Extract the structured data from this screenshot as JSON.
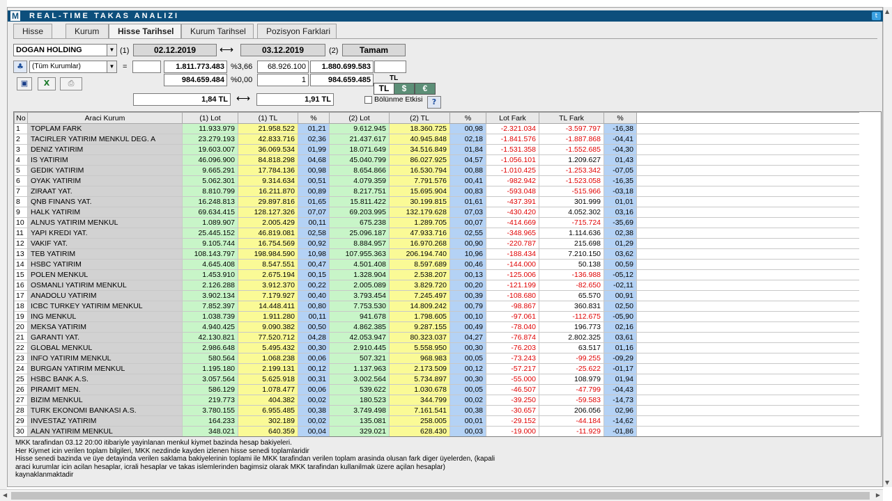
{
  "app": {
    "logo": "M",
    "title": "REAL-TIME TAKAS ANALIZI",
    "twitter_icon": "twitter-icon"
  },
  "tabs": [
    {
      "label": "Hisse",
      "active": false
    },
    {
      "label": "Kurum",
      "active": false
    },
    {
      "label": "Hisse Tarihsel",
      "active": true
    },
    {
      "label": "Kurum Tarihsel",
      "active": false
    },
    {
      "label": "Pozisyon Farklari",
      "active": false
    }
  ],
  "controls": {
    "stock_select": "DOGAN HOLDING",
    "label_1": "(1)",
    "date_1": "02.12.2019",
    "range_arrow": "⟷",
    "date_2": "03.12.2019",
    "label_2": "(2)",
    "ok_button": "Tamam",
    "broker_select": "(Tüm Kurumlar)",
    "equals": "=",
    "r1_total1": "1.811.773.483",
    "r1_pct": "%3,66",
    "r1_diff": "68.926.100",
    "r1_total2": "1.880.699.583",
    "r2_total1": "984.659.484",
    "r2_pct": "%0,00",
    "r2_diff": "1",
    "r2_total2": "984.659.485",
    "currency_label": "TL",
    "cur_tl": "TL",
    "cur_usd": "$",
    "cur_eur": "€",
    "price_1": "1,84 TL",
    "price_2": "1,91 TL",
    "split_effect_label": "Bölünme Etkisi",
    "help": "?"
  },
  "table": {
    "headers": [
      "No",
      "Araci Kurum",
      "(1) Lot",
      "(1) TL",
      "%",
      "(2) Lot",
      "(2) TL",
      "%",
      "Lot Fark",
      "TL Fark",
      "%"
    ],
    "rows": [
      [
        "1",
        "TOPLAM FARK",
        "11.933.979",
        "21.958.522",
        "01,21",
        "9.612.945",
        "18.360.725",
        "00,98",
        "-2.321.034",
        "-3.597.797",
        "-16,38"
      ],
      [
        "2",
        "TACIRLER YATIRIM MENKUL DEG. A",
        "23.279.193",
        "42.833.716",
        "02,36",
        "21.437.617",
        "40.945.848",
        "02,18",
        "-1.841.576",
        "-1.887.868",
        "-04,41"
      ],
      [
        "3",
        "DENIZ YATIRIM",
        "19.603.007",
        "36.069.534",
        "01,99",
        "18.071.649",
        "34.516.849",
        "01,84",
        "-1.531.358",
        "-1.552.685",
        "-04,30"
      ],
      [
        "4",
        "IS YATIRIM",
        "46.096.900",
        "84.818.298",
        "04,68",
        "45.040.799",
        "86.027.925",
        "04,57",
        "-1.056.101",
        "1.209.627",
        "01,43"
      ],
      [
        "5",
        "GEDIK YATIRIM",
        "9.665.291",
        "17.784.136",
        "00,98",
        "8.654.866",
        "16.530.794",
        "00,88",
        "-1.010.425",
        "-1.253.342",
        "-07,05"
      ],
      [
        "6",
        "OYAK YATIRIM",
        "5.062.301",
        "9.314.634",
        "00,51",
        "4.079.359",
        "7.791.576",
        "00,41",
        "-982.942",
        "-1.523.058",
        "-16,35"
      ],
      [
        "7",
        "ZIRAAT YAT.",
        "8.810.799",
        "16.211.870",
        "00,89",
        "8.217.751",
        "15.695.904",
        "00,83",
        "-593.048",
        "-515.966",
        "-03,18"
      ],
      [
        "8",
        "QNB FINANS YAT.",
        "16.248.813",
        "29.897.816",
        "01,65",
        "15.811.422",
        "30.199.815",
        "01,61",
        "-437.391",
        "301.999",
        "01,01"
      ],
      [
        "9",
        "HALK YATIRIM",
        "69.634.415",
        "128.127.326",
        "07,07",
        "69.203.995",
        "132.179.628",
        "07,03",
        "-430.420",
        "4.052.302",
        "03,16"
      ],
      [
        "10",
        "ALNUS YATIRIM MENKUL",
        "1.089.907",
        "2.005.429",
        "00,11",
        "675.238",
        "1.289.705",
        "00,07",
        "-414.669",
        "-715.724",
        "-35,69"
      ],
      [
        "11",
        "YAPI KREDI YAT.",
        "25.445.152",
        "46.819.081",
        "02,58",
        "25.096.187",
        "47.933.716",
        "02,55",
        "-348.965",
        "1.114.636",
        "02,38"
      ],
      [
        "12",
        "VAKIF YAT.",
        "9.105.744",
        "16.754.569",
        "00,92",
        "8.884.957",
        "16.970.268",
        "00,90",
        "-220.787",
        "215.698",
        "01,29"
      ],
      [
        "13",
        "TEB YATIRIM",
        "108.143.797",
        "198.984.590",
        "10,98",
        "107.955.363",
        "206.194.740",
        "10,96",
        "-188.434",
        "7.210.150",
        "03,62"
      ],
      [
        "14",
        "HSBC YATIRIM",
        "4.645.408",
        "8.547.551",
        "00,47",
        "4.501.408",
        "8.597.689",
        "00,46",
        "-144.000",
        "50.138",
        "00,59"
      ],
      [
        "15",
        "POLEN MENKUL",
        "1.453.910",
        "2.675.194",
        "00,15",
        "1.328.904",
        "2.538.207",
        "00,13",
        "-125.006",
        "-136.988",
        "-05,12"
      ],
      [
        "16",
        "OSMANLI YATIRIM MENKUL",
        "2.126.288",
        "3.912.370",
        "00,22",
        "2.005.089",
        "3.829.720",
        "00,20",
        "-121.199",
        "-82.650",
        "-02,11"
      ],
      [
        "17",
        "ANADOLU YATIRIM",
        "3.902.134",
        "7.179.927",
        "00,40",
        "3.793.454",
        "7.245.497",
        "00,39",
        "-108.680",
        "65.570",
        "00,91"
      ],
      [
        "18",
        "ICBC TURKEY YATIRIM MENKUL",
        "7.852.397",
        "14.448.411",
        "00,80",
        "7.753.530",
        "14.809.242",
        "00,79",
        "-98.867",
        "360.831",
        "02,50"
      ],
      [
        "19",
        "ING MENKUL",
        "1.038.739",
        "1.911.280",
        "00,11",
        "941.678",
        "1.798.605",
        "00,10",
        "-97.061",
        "-112.675",
        "-05,90"
      ],
      [
        "20",
        "MEKSA YATIRIM",
        "4.940.425",
        "9.090.382",
        "00,50",
        "4.862.385",
        "9.287.155",
        "00,49",
        "-78.040",
        "196.773",
        "02,16"
      ],
      [
        "21",
        "GARANTI YAT.",
        "42.130.821",
        "77.520.712",
        "04,28",
        "42.053.947",
        "80.323.037",
        "04,27",
        "-76.874",
        "2.802.325",
        "03,61"
      ],
      [
        "22",
        "GLOBAL MENKUL",
        "2.986.648",
        "5.495.432",
        "00,30",
        "2.910.445",
        "5.558.950",
        "00,30",
        "-76.203",
        "63.517",
        "01,16"
      ],
      [
        "23",
        "INFO YATIRIM MENKUL",
        "580.564",
        "1.068.238",
        "00,06",
        "507.321",
        "968.983",
        "00,05",
        "-73.243",
        "-99.255",
        "-09,29"
      ],
      [
        "24",
        "BURGAN YATIRIM MENKUL",
        "1.195.180",
        "2.199.131",
        "00,12",
        "1.137.963",
        "2.173.509",
        "00,12",
        "-57.217",
        "-25.622",
        "-01,17"
      ],
      [
        "25",
        "HSBC BANK A.S.",
        "3.057.564",
        "5.625.918",
        "00,31",
        "3.002.564",
        "5.734.897",
        "00,30",
        "-55.000",
        "108.979",
        "01,94"
      ],
      [
        "26",
        "PIRAMIT MEN.",
        "586.129",
        "1.078.477",
        "00,06",
        "539.622",
        "1.030.678",
        "00,05",
        "-46.507",
        "-47.799",
        "-04,43"
      ],
      [
        "27",
        "BIZIM MENKUL",
        "219.773",
        "404.382",
        "00,02",
        "180.523",
        "344.799",
        "00,02",
        "-39.250",
        "-59.583",
        "-14,73"
      ],
      [
        "28",
        "TURK EKONOMI BANKASI A.S.",
        "3.780.155",
        "6.955.485",
        "00,38",
        "3.749.498",
        "7.161.541",
        "00,38",
        "-30.657",
        "206.056",
        "02,96"
      ],
      [
        "29",
        "INVESTAZ YATIRIM",
        "164.233",
        "302.189",
        "00,02",
        "135.081",
        "258.005",
        "00,01",
        "-29.152",
        "-44.184",
        "-14,62"
      ],
      [
        "30",
        "ALAN YATIRIM MENKUL",
        "348.021",
        "640.359",
        "00,04",
        "329.021",
        "628.430",
        "00,03",
        "-19.000",
        "-11.929",
        "-01,86"
      ]
    ]
  },
  "footer": {
    "line1": "MKK tarafindan 03.12 20:00 itibariyle yayinlanan menkul kiymet bazinda hesap bakiyeleri.",
    "line2": "Her Kiymet icin verilen toplam bilgileri, MKK nezdinde kayden izlenen hisse senedi toplamlaridir",
    "line3": "Hisse senedi bazinda ve üye detayinda verilen saklama bakiyelerinin toplami ile MKK tarafindan verilen toplam arasinda olusan fark diger üyelerden, (kapali",
    "line4": "araci kurumlar icin acilan hesaplar, icrali hesaplar ve takas islemlerinden bagimsiz olarak MKK tarafindan kullanilmak üzere açilan hesaplar)",
    "line5": "kaynaklanmaktadir"
  }
}
